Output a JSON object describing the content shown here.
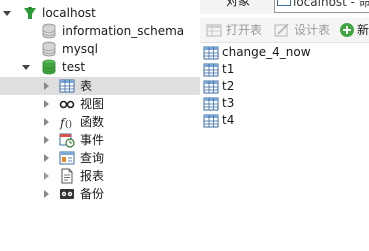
{
  "tree": {
    "connection": "localhost",
    "databases": [
      {
        "name": "information_schema"
      },
      {
        "name": "mysql"
      },
      {
        "name": "test"
      }
    ],
    "groups": [
      {
        "label": "表",
        "icon": "table-icon"
      },
      {
        "label": "视图",
        "icon": "view-glasses-icon"
      },
      {
        "label": "函数",
        "icon": "function-icon"
      },
      {
        "label": "事件",
        "icon": "event-clock-icon"
      },
      {
        "label": "查询",
        "icon": "query-icon"
      },
      {
        "label": "报表",
        "icon": "report-icon"
      },
      {
        "label": "备份",
        "icon": "backup-icon"
      }
    ]
  },
  "right": {
    "tab_objects": "对象",
    "tab_query": "localhost - 命",
    "toolbar": {
      "open_table": "打开表",
      "design_table": "设计表",
      "new": "新"
    },
    "tables": [
      "change_4_now",
      "t1",
      "t2",
      "t3",
      "t4"
    ]
  },
  "colors": {
    "selection": "#dfdfdf",
    "db_green": "#3fa63f",
    "connection_green": "#2e9b3a"
  }
}
